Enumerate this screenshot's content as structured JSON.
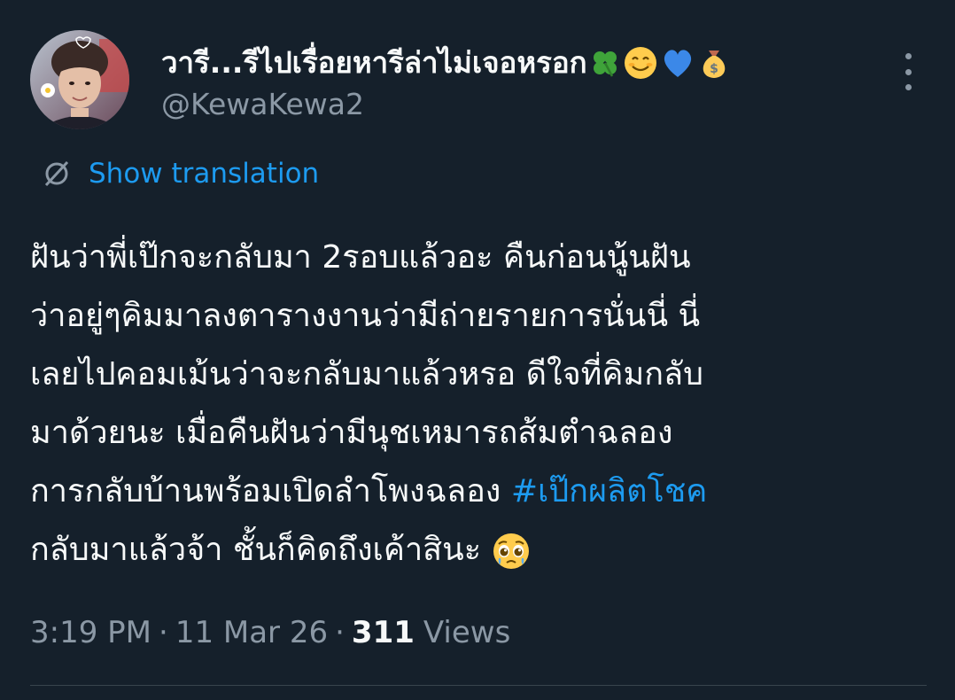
{
  "author": {
    "display_name": "วารี...รีไปเรื่อยหารีล่าไม่เจอหรอก",
    "display_name_emojis": [
      "four-leaf-clover",
      "smiling-face",
      "blue-heart",
      "money-bag"
    ],
    "handle": "@KewaKewa2"
  },
  "translate": {
    "label": "Show translation"
  },
  "tweet": {
    "lines": [
      "ฝันว่าพี่เป๊กจะกลับมา 2รอบแล้วอะ คืนก่อนนู้นฝัน",
      "ว่าอยู่ๆคิมมาลงตารางงานว่ามีถ่ายรายการนั่นนี่ นี่",
      "เลยไปคอมเม้นว่าจะกลับมาแล้วหรอ ดีใจที่คิมกลับ",
      "มาด้วยนะ เมื่อคืนฝันว่ามีนุชเหมารถส้มตำฉลอง"
    ],
    "line5_text": "การกลับบ้านพร้อมเปิดลำโพงฉลอง ",
    "hashtag": "#เป๊กผลิตโชค",
    "line6_text": "กลับมาแล้วจ้า ชั้นก็คิดถึงเค้าสินะ",
    "end_emoji": "pleading-face"
  },
  "meta": {
    "time": "3:19 PM",
    "separator": "·",
    "date": "11 Mar 26",
    "views_count": "311",
    "views_label": "Views"
  },
  "colors": {
    "background": "#15202b",
    "text": "#f7f9f9",
    "secondary": "#8b98a5",
    "accent": "#1d9bf0",
    "divider": "#38444d"
  }
}
